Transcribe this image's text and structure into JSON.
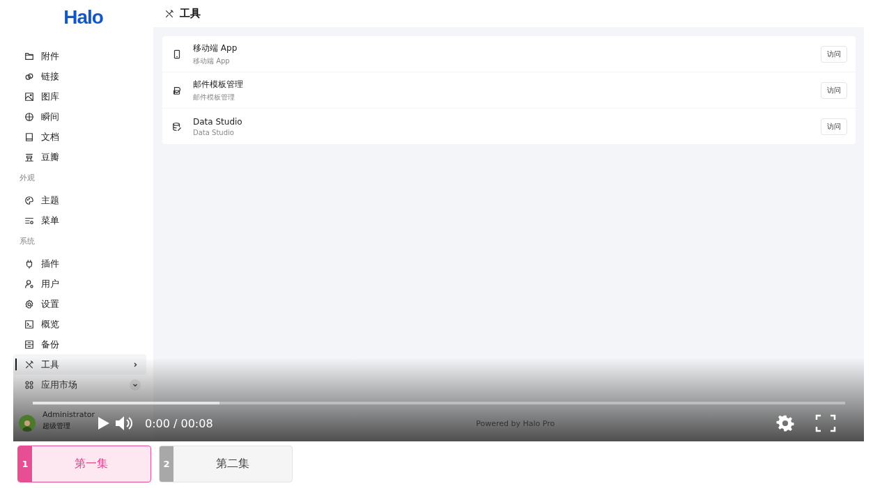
{
  "sidebar": {
    "logo": "Halo",
    "sections": [
      {
        "items": [
          {
            "label": "附件",
            "selected": false
          },
          {
            "label": "链接",
            "selected": false
          },
          {
            "label": "图库",
            "selected": false
          },
          {
            "label": "瞬间",
            "selected": false
          },
          {
            "label": "文档",
            "selected": false
          },
          {
            "label": "豆瓣",
            "selected": false
          }
        ]
      },
      {
        "title": "外观",
        "items": [
          {
            "label": "主题",
            "selected": false
          },
          {
            "label": "菜单",
            "selected": false
          }
        ]
      },
      {
        "title": "系统",
        "items": [
          {
            "label": "插件",
            "selected": false
          },
          {
            "label": "用户",
            "selected": false
          },
          {
            "label": "设置",
            "selected": false
          },
          {
            "label": "概览",
            "selected": false
          },
          {
            "label": "备份",
            "selected": false
          },
          {
            "label": "工具",
            "selected": true,
            "expanded": false
          },
          {
            "label": "应用市场",
            "selected": false,
            "expanded": true
          }
        ]
      }
    ],
    "user": {
      "name": "Administrator",
      "role": "超级管理"
    }
  },
  "page": {
    "title": "工具",
    "tools": [
      {
        "name": "移动端 App",
        "description": "移动端 App",
        "action": "访问"
      },
      {
        "name": "邮件模板管理",
        "description": "邮件模板管理",
        "action": "访问"
      },
      {
        "name": "Data Studio",
        "description": "Data Studio",
        "action": "访问"
      }
    ]
  },
  "player": {
    "progress": {
      "level": 0.23
    },
    "time": "0:00 / 00:08",
    "credit": "Powered by Halo Pro"
  },
  "episodes": [
    {
      "number": "1",
      "title": "第一集",
      "selected": true
    },
    {
      "number": "2",
      "title": "第二集",
      "selected": false
    }
  ]
}
